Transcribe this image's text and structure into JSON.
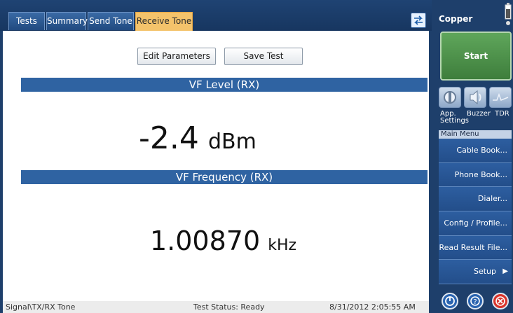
{
  "tabs": [
    {
      "label": "Tests",
      "active": false
    },
    {
      "label": "Summary",
      "active": false
    },
    {
      "label": "Send Tone",
      "active": false
    },
    {
      "label": "Receive Tone",
      "active": true
    }
  ],
  "toolbar": {
    "edit_label": "Edit Parameters",
    "save_label": "Save Test"
  },
  "level": {
    "header": "VF Level (RX)",
    "value": "-2.4",
    "unit": "dBm"
  },
  "frequency": {
    "header": "VF Frequency (RX)",
    "value": "1.00870",
    "unit": "kHz"
  },
  "status": {
    "path": "Signal\\TX/RX Tone",
    "test_status": "Test Status: Ready",
    "datetime": "8/31/2012 2:05:55 AM"
  },
  "sidebar": {
    "title": "Copper",
    "start_label": "Start",
    "icons": [
      {
        "name": "wrench-icon",
        "label": "App. Settings"
      },
      {
        "name": "speaker-icon",
        "label": "Buzzer"
      },
      {
        "name": "waveform-icon",
        "label": "TDR"
      }
    ],
    "menu_header": "Main Menu",
    "menu_items": [
      {
        "label": "Cable Book..."
      },
      {
        "label": "Phone Book..."
      },
      {
        "label": "Dialer..."
      },
      {
        "label": "Config / Profile..."
      },
      {
        "label": "Read Result File..."
      },
      {
        "label": "Setup",
        "arrow": "▶"
      }
    ]
  },
  "colors": {
    "accent_tab": "#f4c36b",
    "section_bar": "#2f63a2",
    "start_green": "#4e9150",
    "close_red": "#d9342b"
  }
}
